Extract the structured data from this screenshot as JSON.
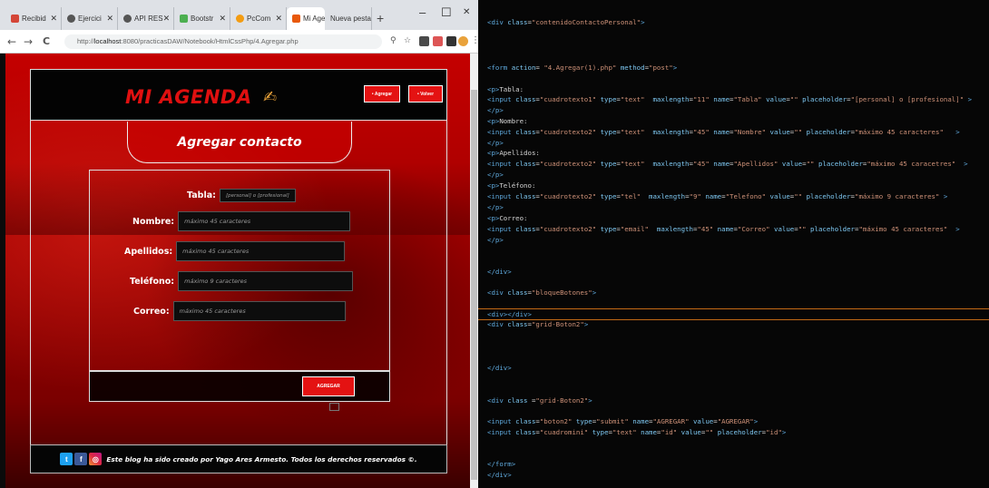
{
  "browser": {
    "tabs": [
      {
        "label": "Recibid",
        "color": "#d44638",
        "icon": "gmail-icon"
      },
      {
        "label": "Ejercici",
        "color": "#555555",
        "icon": "globe-icon"
      },
      {
        "label": "API RES",
        "color": "#555555",
        "icon": "globe-icon"
      },
      {
        "label": "Bootstr",
        "color": "#4caf50",
        "icon": "bootstrap-icon"
      },
      {
        "label": "PcCom",
        "color": "#f39c12",
        "icon": "pccom-icon"
      },
      {
        "label": "Mi Age",
        "color": "#e8590c",
        "icon": "agenda-icon"
      },
      {
        "label": "Nueva pesta",
        "color": "",
        "icon": ""
      }
    ],
    "new_tab": "+",
    "window": {
      "minimize": "–",
      "maximize": "☐",
      "close": "✕"
    },
    "nav": {
      "back": "←",
      "forward": "→",
      "reload": "C"
    },
    "url_prefix": "http://",
    "url_host": "localhost",
    "url_rest": ":8080/practicasDAW/Notebook/HtmlCssPhp/4.Agregar.php"
  },
  "site": {
    "logo": "MI AGENDA",
    "header_buttons": {
      "agregar": "• Agregar",
      "volver": "• Volver"
    },
    "title": "Agregar contacto",
    "fields": [
      {
        "label": "Tabla:",
        "placeholder": "[personal] o [profesional]"
      },
      {
        "label": "Nombre:",
        "placeholder": "máximo 45 caracteres"
      },
      {
        "label": "Apellidos:",
        "placeholder": "máximo 45 caracteres"
      },
      {
        "label": "Teléfono:",
        "placeholder": "máximo 9 caracteres"
      },
      {
        "label": "Correo:",
        "placeholder": "máximo 45 caracteres"
      }
    ],
    "submit": "AGREGAR",
    "footer_text": "Este blog ha sido creado por Yago Ares Armesto. Todos los derechos reservados ©."
  },
  "code_lines": [
    [
      [
        "tg",
        "<div "
      ],
      [
        "at",
        "class"
      ],
      [
        "tx",
        "="
      ],
      [
        "vl",
        "\"contenidoContactoPersonal\""
      ],
      [
        "tg",
        ">"
      ]
    ],
    [
      [
        "tg",
        "<form "
      ],
      [
        "at",
        "action"
      ],
      [
        "tx",
        "= "
      ],
      [
        "vl",
        "\"4.Agregar(1).php\""
      ],
      [
        "at",
        " method"
      ],
      [
        "tx",
        "="
      ],
      [
        "vl",
        "\"post\""
      ],
      [
        "tg",
        ">"
      ]
    ],
    [
      [
        "tg",
        "<p>"
      ],
      [
        "tx",
        "Tabla:"
      ]
    ],
    [
      [
        "tg",
        "<input "
      ],
      [
        "at",
        "class"
      ],
      [
        "tx",
        "="
      ],
      [
        "vl",
        "\"cuadrotexto1\""
      ],
      [
        "at",
        " type"
      ],
      [
        "tx",
        "="
      ],
      [
        "vl",
        "\"text\""
      ],
      [
        "at",
        "  maxlength"
      ],
      [
        "tx",
        "="
      ],
      [
        "vl",
        "\"11\""
      ],
      [
        "at",
        " name"
      ],
      [
        "tx",
        "="
      ],
      [
        "vl",
        "\"Tabla\""
      ],
      [
        "at",
        " value"
      ],
      [
        "tx",
        "="
      ],
      [
        "vl",
        "\"\""
      ],
      [
        "at",
        " placeholder"
      ],
      [
        "tx",
        "="
      ],
      [
        "vl",
        "\"[personal] o [profesional]\""
      ],
      [
        "tg",
        " >"
      ]
    ],
    [
      [
        "tg",
        "</p>"
      ]
    ],
    [
      [
        "tg",
        "<p>"
      ],
      [
        "tx",
        "Nombre:"
      ]
    ],
    [
      [
        "tg",
        "<input "
      ],
      [
        "at",
        "class"
      ],
      [
        "tx",
        "="
      ],
      [
        "vl",
        "\"cuadrotexto2\""
      ],
      [
        "at",
        " type"
      ],
      [
        "tx",
        "="
      ],
      [
        "vl",
        "\"text\""
      ],
      [
        "at",
        "  maxlength"
      ],
      [
        "tx",
        "="
      ],
      [
        "vl",
        "\"45\""
      ],
      [
        "at",
        " name"
      ],
      [
        "tx",
        "="
      ],
      [
        "vl",
        "\"Nombre\""
      ],
      [
        "at",
        " value"
      ],
      [
        "tx",
        "="
      ],
      [
        "vl",
        "\"\""
      ],
      [
        "at",
        " placeholder"
      ],
      [
        "tx",
        "="
      ],
      [
        "vl",
        "\"máximo 45 caracteres\""
      ],
      [
        "tg",
        "   >"
      ]
    ],
    [
      [
        "tg",
        "</p>"
      ]
    ],
    [
      [
        "tg",
        "<p>"
      ],
      [
        "tx",
        "Apellidos:"
      ]
    ],
    [
      [
        "tg",
        "<input "
      ],
      [
        "at",
        "class"
      ],
      [
        "tx",
        "="
      ],
      [
        "vl",
        "\"cuadrotexto2\""
      ],
      [
        "at",
        " type"
      ],
      [
        "tx",
        "="
      ],
      [
        "vl",
        "\"text\""
      ],
      [
        "at",
        "  maxlength"
      ],
      [
        "tx",
        "="
      ],
      [
        "vl",
        "\"45\""
      ],
      [
        "at",
        " name"
      ],
      [
        "tx",
        "="
      ],
      [
        "vl",
        "\"Apellidos\""
      ],
      [
        "at",
        " value"
      ],
      [
        "tx",
        "="
      ],
      [
        "vl",
        "\"\""
      ],
      [
        "at",
        " placeholder"
      ],
      [
        "tx",
        "="
      ],
      [
        "vl",
        "\"máximo 45 caracetres\""
      ],
      [
        "tg",
        "  >"
      ]
    ],
    [
      [
        "tg",
        "</p>"
      ]
    ],
    [
      [
        "tg",
        "<p>"
      ],
      [
        "tx",
        "Teléfono:"
      ]
    ],
    [
      [
        "tg",
        "<input "
      ],
      [
        "at",
        "class"
      ],
      [
        "tx",
        "="
      ],
      [
        "vl",
        "\"cuadrotexto2\""
      ],
      [
        "at",
        " type"
      ],
      [
        "tx",
        "="
      ],
      [
        "vl",
        "\"tel\""
      ],
      [
        "at",
        "  maxlength"
      ],
      [
        "tx",
        "="
      ],
      [
        "vl",
        "\"9\""
      ],
      [
        "at",
        " name"
      ],
      [
        "tx",
        "="
      ],
      [
        "vl",
        "\"Telefono\""
      ],
      [
        "at",
        " value"
      ],
      [
        "tx",
        "="
      ],
      [
        "vl",
        "\"\""
      ],
      [
        "at",
        " placeholder"
      ],
      [
        "tx",
        "="
      ],
      [
        "vl",
        "\"máximo 9 caracteres\""
      ],
      [
        "tg",
        " >"
      ]
    ],
    [
      [
        "tg",
        "</p>"
      ]
    ],
    [
      [
        "tg",
        "<p>"
      ],
      [
        "tx",
        "Correo:"
      ]
    ],
    [
      [
        "tg",
        "<input "
      ],
      [
        "at",
        "class"
      ],
      [
        "tx",
        "="
      ],
      [
        "vl",
        "\"cuadrotexto2\""
      ],
      [
        "at",
        " type"
      ],
      [
        "tx",
        "="
      ],
      [
        "vl",
        "\"email\""
      ],
      [
        "at",
        "  maxlength"
      ],
      [
        "tx",
        "="
      ],
      [
        "vl",
        "\"45\""
      ],
      [
        "at",
        " name"
      ],
      [
        "tx",
        "="
      ],
      [
        "vl",
        "\"Correo\""
      ],
      [
        "at",
        " value"
      ],
      [
        "tx",
        "="
      ],
      [
        "vl",
        "\"\""
      ],
      [
        "at",
        " placeholder"
      ],
      [
        "tx",
        "="
      ],
      [
        "vl",
        "\"máximo 45 caracteres\""
      ],
      [
        "tg",
        "  >"
      ]
    ],
    [
      [
        "tg",
        "</p>"
      ]
    ],
    [
      [
        "tg",
        "</div>"
      ]
    ],
    [
      [
        "tg",
        "<div "
      ],
      [
        "at",
        "class"
      ],
      [
        "tx",
        "="
      ],
      [
        "vl",
        "\"bloqueBotones\""
      ],
      [
        "tg",
        ">"
      ]
    ],
    [
      [
        "tg",
        "<div></div>"
      ]
    ],
    [
      [
        "tg",
        "<div "
      ],
      [
        "at",
        "class"
      ],
      [
        "tx",
        "="
      ],
      [
        "vl",
        "\"grid-Boton2\""
      ],
      [
        "tg",
        ">"
      ]
    ],
    [
      [
        "tg",
        "</div>"
      ]
    ],
    [
      [
        "tg",
        "<div "
      ],
      [
        "at",
        "class "
      ],
      [
        "tx",
        "="
      ],
      [
        "vl",
        "\"grid-Boton2\""
      ],
      [
        "tg",
        ">"
      ]
    ],
    [
      [
        "tg",
        "<input "
      ],
      [
        "at",
        "class"
      ],
      [
        "tx",
        "="
      ],
      [
        "vl",
        "\"boton2\""
      ],
      [
        "at",
        " type"
      ],
      [
        "tx",
        "="
      ],
      [
        "vl",
        "\"submit\""
      ],
      [
        "at",
        " name"
      ],
      [
        "tx",
        "="
      ],
      [
        "vl",
        "\"AGREGAR\""
      ],
      [
        "at",
        " value"
      ],
      [
        "tx",
        "="
      ],
      [
        "vl",
        "\"AGREGAR\""
      ],
      [
        "tg",
        ">"
      ]
    ],
    [
      [
        "tg",
        "<input "
      ],
      [
        "at",
        "class"
      ],
      [
        "tx",
        "="
      ],
      [
        "vl",
        "\"cuadromini\""
      ],
      [
        "at",
        " type"
      ],
      [
        "tx",
        "="
      ],
      [
        "vl",
        "\"text\""
      ],
      [
        "at",
        " name"
      ],
      [
        "tx",
        "="
      ],
      [
        "vl",
        "\"id\""
      ],
      [
        "at",
        " value"
      ],
      [
        "tx",
        "="
      ],
      [
        "vl",
        "\"\""
      ],
      [
        "at",
        " placeholder"
      ],
      [
        "tx",
        "="
      ],
      [
        "vl",
        "\"id\""
      ],
      [
        "tg",
        ">"
      ]
    ],
    [
      [
        "tg",
        "</form>"
      ]
    ],
    [
      [
        "tg",
        "</div>"
      ]
    ]
  ]
}
